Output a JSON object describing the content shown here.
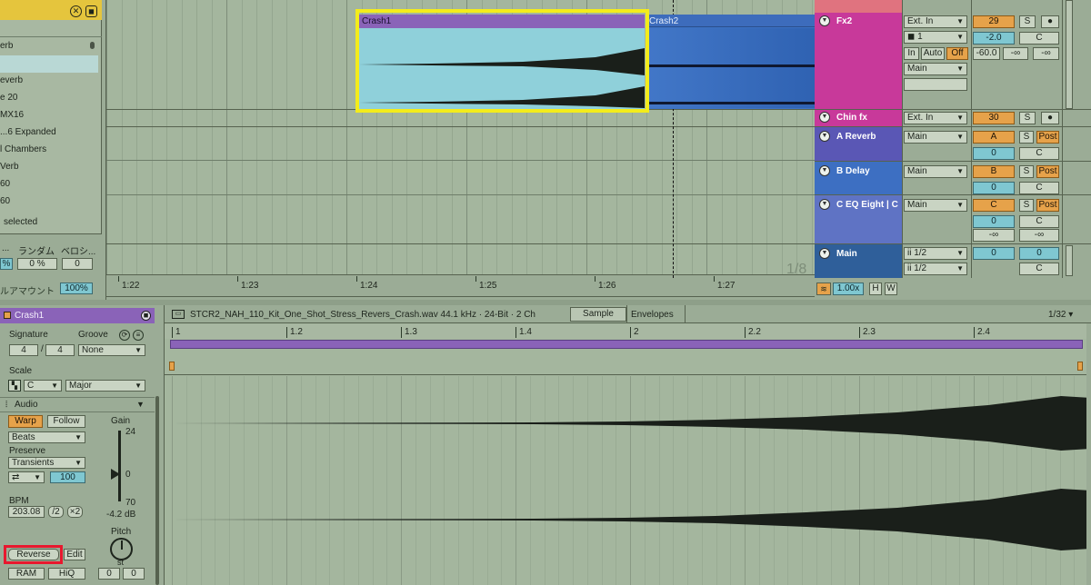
{
  "browser": {
    "items": [
      "erb",
      "",
      "everb",
      "e 20",
      "MX16",
      "...6 Expanded",
      "l Chambers",
      "Verb",
      "60",
      "60"
    ],
    "status": "selected",
    "row_labels": [
      "...",
      "ランダム",
      "ベロシ..."
    ],
    "row_values": [
      "%",
      "0 %",
      "0"
    ],
    "amount_label": "ルアマウント",
    "amount_value": "100%"
  },
  "arrangement": {
    "clips": [
      {
        "name": "Crash1"
      },
      {
        "name": "Crash2"
      }
    ],
    "ruler": [
      "1:22",
      "1:23",
      "1:24",
      "1:25",
      "1:26",
      "1:27"
    ],
    "grid": "1/8",
    "zoom": "1.00x",
    "h": "H",
    "w": "W"
  },
  "tracks": [
    {
      "name": "Fx2",
      "color": "#c8399a",
      "input": "Ext. In",
      "channel": "1",
      "monitor": [
        "In",
        "Auto",
        "Off"
      ],
      "output": "Main",
      "volume": "29",
      "pan": "-2.0",
      "solo": "S",
      "send_a": "C",
      "low": "-60.0",
      "inf1": "-∞",
      "inf2": "-∞"
    },
    {
      "name": "Chin fx",
      "color": "#c8399a",
      "input": "Ext. In",
      "volume": "30",
      "solo": "S"
    },
    {
      "name": "A Reverb",
      "color": "#5a57b5",
      "output": "Main",
      "volume": "A",
      "solo": "S",
      "post": "Post",
      "val": "0",
      "c": "C"
    },
    {
      "name": "B Delay",
      "color": "#3d6fc2",
      "output": "Main",
      "volume": "B",
      "solo": "S",
      "post": "Post",
      "val": "0",
      "c": "C"
    },
    {
      "name": "C EQ Eight | C",
      "color": "#5f73c4",
      "output": "Main",
      "volume": "C",
      "solo": "S",
      "post": "Post",
      "val": "0",
      "c": "C",
      "inf1": "-∞",
      "inf2": "-∞"
    },
    {
      "name": "Main",
      "color": "#2f5f9a",
      "out1": "ii 1/2",
      "out2": "ii 1/2",
      "val1": "0",
      "val2": "0",
      "c": "C"
    }
  ],
  "clip": {
    "name": "Crash1",
    "signature_label": "Signature",
    "groove_label": "Groove",
    "sig_num": "4",
    "sig_den": "4",
    "groove": "None",
    "scale_label": "Scale",
    "scale_root": "C",
    "scale_mode": "Major",
    "audio_label": "Audio",
    "warp": "Warp",
    "follow": "Follow",
    "warp_mode": "Beats",
    "preserve_label": "Preserve",
    "preserve": "Transients",
    "loop_value": "100",
    "bpm_label": "BPM",
    "bpm": "203.08",
    "half": "/2",
    "double": "×2",
    "gain_label": "Gain",
    "gain_max": "24",
    "gain_zero": "0",
    "gain_min": "70",
    "gain_db": "-4.2 dB",
    "pitch_label": "Pitch",
    "pitch_unit": "st",
    "pitch_st": "0",
    "pitch_cent": "0",
    "reverse": "Reverse",
    "edit": "Edit",
    "ram": "RAM",
    "hiq": "HiQ"
  },
  "sample": {
    "file": "STCR2_NAH_110_Kit_One_Shot_Stress_Revers_Crash.wav 44.1 kHz · 24-Bit · 2 Ch",
    "tabs": [
      "Sample",
      "Envelopes"
    ],
    "grid": "1/32 ▾",
    "ruler": [
      "1",
      "1.2",
      "1.3",
      "1.4",
      "2",
      "2.2",
      "2.3",
      "2.4"
    ]
  },
  "colors": {
    "clip_purple": "#8a63b8",
    "clip_blue": "#3c72c4",
    "highlight_yellow": "#f3ec1b",
    "highlight_red": "#e8182e",
    "accent_orange": "#e6a24a"
  }
}
